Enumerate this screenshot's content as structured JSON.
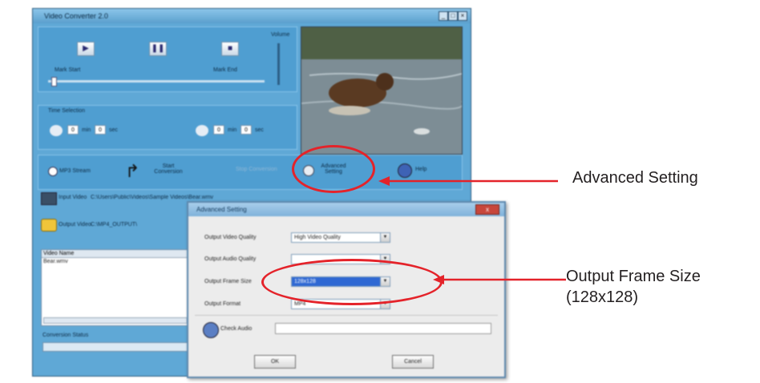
{
  "app": {
    "title": "Video Converter 2.0",
    "min": "_",
    "max": "□",
    "close": "×",
    "player": {
      "play_icon": "▶",
      "pause_icon": "❚❚",
      "stop_icon": "■",
      "start_label": "Mark Start",
      "end_label": "Mark End",
      "volume_label": "Volume"
    },
    "conversion_time": {
      "heading": "Time Selection",
      "start_min": "0",
      "start_sec": "0",
      "min_unit": "min",
      "sec_unit": "sec",
      "end_min": "0",
      "end_sec": "0"
    },
    "actions": {
      "mp3": "MP3 Stream",
      "start_conversion": "Start Conversion",
      "stop_conversion": "Stop Conversion",
      "advanced": "Advanced Setting",
      "help": "Help"
    },
    "input_video_label": "Input Video",
    "input_video_path": "C:\\Users\\Public\\Videos\\Sample Videos\\Bear.wmv",
    "output_video_label": "Output Video",
    "output_video_path": "C:\\MP4_OUTPUT\\",
    "list_header": "Video Name",
    "list_items": [
      "Bear.wmv"
    ],
    "conversion_status_label": "Conversion Status"
  },
  "dialog": {
    "title": "Advanced Setting",
    "close": "x",
    "rows": [
      {
        "label": "Output Video Quality",
        "value": "High Video Quality"
      },
      {
        "label": "Output Audio Quality",
        "value": ""
      },
      {
        "label": "Output Frame Size",
        "value": "128x128"
      },
      {
        "label": "Output Format",
        "value": "MP4"
      }
    ],
    "check_label": "Check Audio",
    "ok": "OK",
    "cancel": "Cancel"
  },
  "annotations": {
    "advanced": "Advanced Setting",
    "frame_size_line1": "Output Frame Size",
    "frame_size_line2": "(128x128)"
  },
  "colors": {
    "app_bg": "#5fa8d6",
    "highlight": "#e4232a",
    "selected_row": "#2f68d3"
  }
}
